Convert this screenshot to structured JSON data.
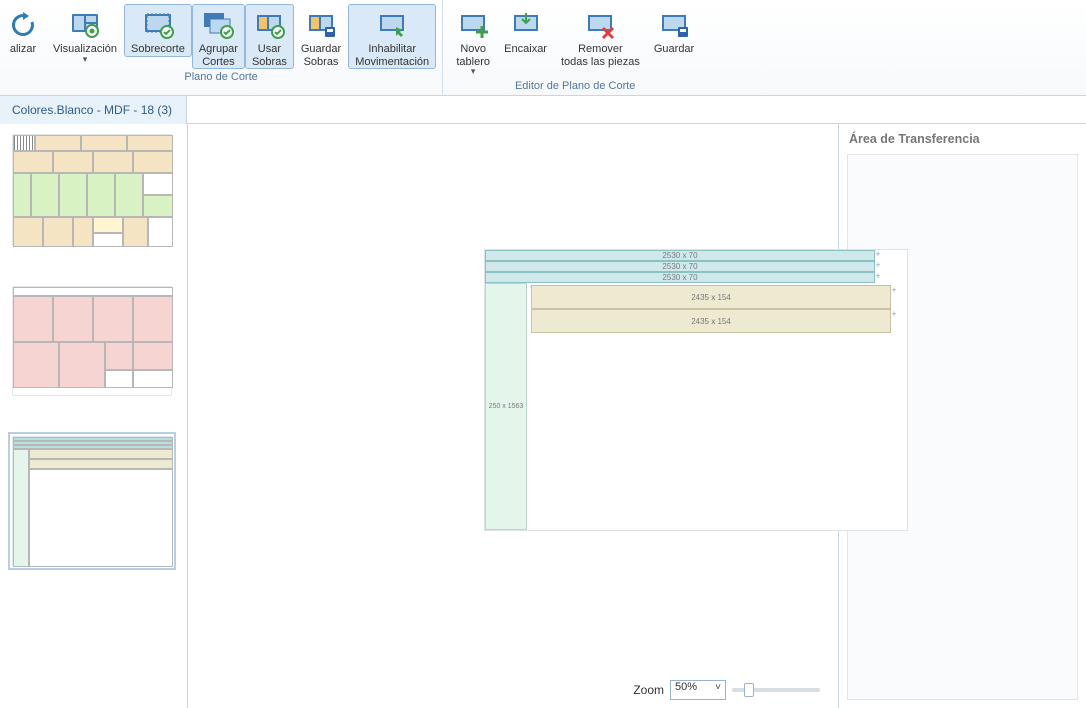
{
  "ribbon": {
    "groups": [
      {
        "label": "Plano de Corte",
        "buttons": [
          {
            "id": "btn-alizar",
            "label": "alizar",
            "dropdown": false,
            "selected": false
          },
          {
            "id": "btn-visualizacion",
            "label": "Visualización",
            "dropdown": true,
            "selected": false
          },
          {
            "id": "btn-sobrecorte",
            "label": "Sobrecorte",
            "dropdown": false,
            "selected": true
          },
          {
            "id": "btn-agrupar",
            "label": "Agrupar\nCortes",
            "dropdown": false,
            "selected": true
          },
          {
            "id": "btn-usar-sobras",
            "label": "Usar\nSobras",
            "dropdown": false,
            "selected": true
          },
          {
            "id": "btn-guardar-sobras",
            "label": "Guardar\nSobras",
            "dropdown": false,
            "selected": false
          },
          {
            "id": "btn-inhabilitar",
            "label": "Inhabilitar\nMovimentación",
            "dropdown": false,
            "selected": true
          }
        ]
      },
      {
        "label": "Editor de Plano de Corte",
        "buttons": [
          {
            "id": "btn-novo-tablero",
            "label": "Novo\ntablero",
            "dropdown": true,
            "selected": false
          },
          {
            "id": "btn-encaixar",
            "label": "Encaixar",
            "dropdown": false,
            "selected": false
          },
          {
            "id": "btn-remover",
            "label": "Remover\ntodas las piezas",
            "dropdown": false,
            "selected": false
          },
          {
            "id": "btn-guardar",
            "label": "Guardar",
            "dropdown": false,
            "selected": false
          }
        ]
      }
    ]
  },
  "tab": {
    "label": "Colores.Blanco - MDF - 18 (3)"
  },
  "transfer": {
    "title": "Área de Transferencia"
  },
  "zoom": {
    "label": "Zoom",
    "value": "50%"
  },
  "canvas": {
    "strips": [
      {
        "label": "2530 x 70"
      },
      {
        "label": "2530 x 70"
      },
      {
        "label": "2530 x 70"
      }
    ],
    "bars": [
      {
        "label": "2435 x 154"
      },
      {
        "label": "2435 x 154"
      }
    ],
    "left_piece": {
      "label": "250 x 1563"
    }
  },
  "colors": {
    "teal": "#b8e0e0",
    "tan": "#eeead2",
    "mint": "#e4f5ec"
  }
}
